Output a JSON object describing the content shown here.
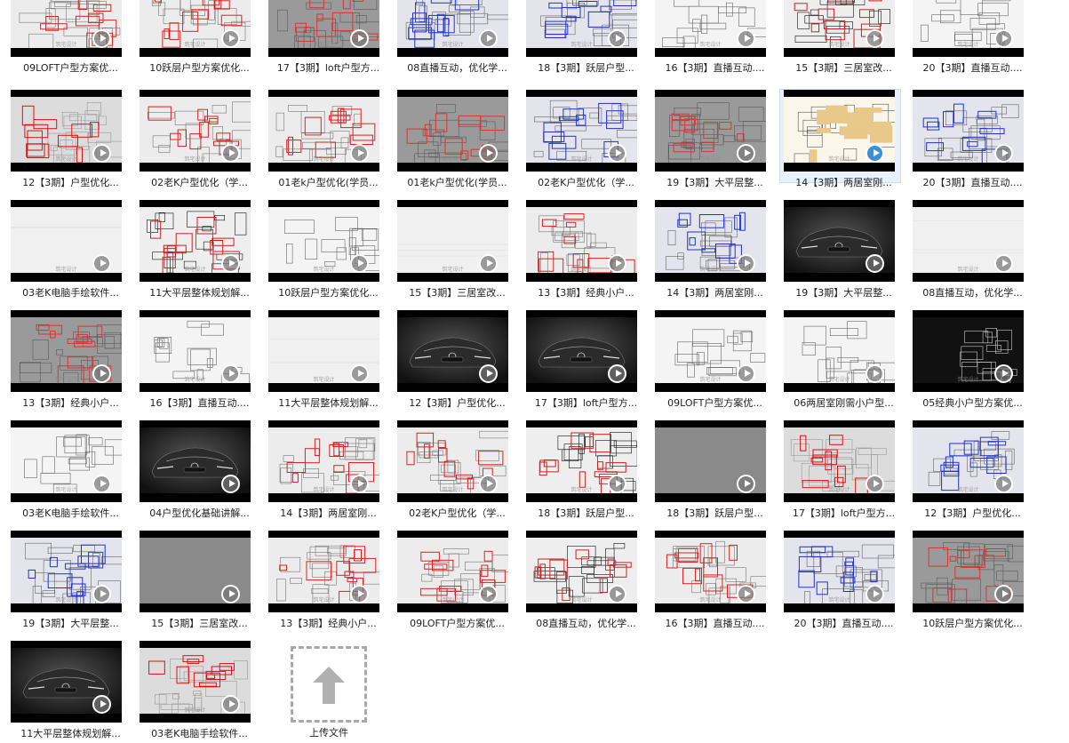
{
  "watermark": "筑宅设计",
  "upload_label": "上传文件",
  "colors": {
    "selected_bg": "#e6f1fb",
    "play_active": "#3f8fd5"
  },
  "rows": [
    [
      "09LOFT户型方案优...",
      "10跃层户型方案优化...",
      "17【3期】loft户型方...",
      "08直播互动，优化学...",
      "18【3期】跃层户型...",
      "16【3期】直播互动....",
      "15【3期】三居室改...",
      "20【3期】直播互动...."
    ],
    [
      "12【3期】户型优化...",
      "02老K户型优化（学...",
      "01老k户型优化(学员...",
      "01老k户型优化(学员...",
      "02老K户型优化（学...",
      "19【3期】大平层整...",
      "14【3期】两居室刚...",
      "20【3期】直播互动...."
    ],
    [
      "03老K电脑手绘软件...",
      "11大平层整体规划解...",
      "10跃层户型方案优化...",
      "15【3期】三居室改...",
      "13【3期】经典小户...",
      "14【3期】两居室刚...",
      "19【3期】大平层整...",
      "08直播互动，优化学..."
    ],
    [
      "13【3期】经典小户...",
      "16【3期】直播互动....",
      "11大平层整体规划解...",
      "12【3期】户型优化...",
      "17【3期】loft户型方...",
      "09LOFT户型方案优...",
      "06两居室刚需小户型...",
      "05经典小户型方案优..."
    ],
    [
      "03老K电脑手绘软件...",
      "04户型优化基础讲解...",
      "14【3期】两居室刚...",
      "02老K户型优化（学...",
      "18【3期】跃层户型...",
      "18【3期】跃层户型...",
      "17【3期】loft户型方...",
      "12【3期】户型优化..."
    ],
    [
      "19【3期】大平层整...",
      "15【3期】三居室改...",
      "13【3期】经典小户...",
      "09LOFT户型方案优...",
      "08直播互动，优化学...",
      "16【3期】直播互动....",
      "20【3期】直播互动....",
      "10跃层户型方案优化..."
    ],
    [
      "11大平层整体规划解...",
      "03老K电脑手绘软件..."
    ]
  ],
  "kinds": [
    [
      "redplan",
      "redplan",
      "greyplan",
      "blueplan",
      "blueplan",
      "whiteplan",
      "blackplan",
      "whiteplan"
    ],
    [
      "red3d",
      "redplan",
      "redplan",
      "greyplan",
      "blueplan",
      "greyplan",
      "colorplan",
      "blueplan"
    ],
    [
      "white",
      "blackplan",
      "whiteplan",
      "white",
      "redplan",
      "blueplan",
      "car",
      "white"
    ],
    [
      "greyplan",
      "whiteplan",
      "white",
      "car",
      "car",
      "whiteplan",
      "whiteplan",
      "darkplan"
    ],
    [
      "whiteplan",
      "car",
      "redplan",
      "redplan",
      "blackplan",
      "grey",
      "red3d",
      "blueplan"
    ],
    [
      "blueplan",
      "grey",
      "redplan",
      "redplan",
      "blackplan",
      "redplan",
      "blueplan",
      "greyplan"
    ],
    [
      "car",
      "red3d"
    ]
  ],
  "selected": {
    "row": 1,
    "col": 6
  }
}
